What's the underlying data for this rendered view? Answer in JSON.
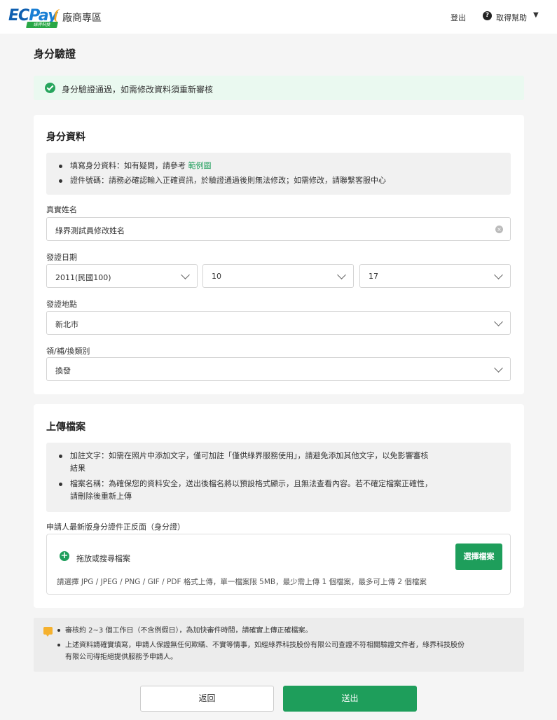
{
  "header": {
    "logo_text_ec": "EC",
    "logo_text_pay": "Pay",
    "logo_tagline": "綠界科技",
    "portal_title": "廠商專區",
    "logout_label": "登出",
    "help_label": "取得幫助"
  },
  "page": {
    "title": "身分驗證",
    "success_message": "身分驗證通過，如需修改資料須重新審核"
  },
  "identity_section": {
    "title": "身分資料",
    "notes": [
      {
        "text": "填寫身分資料：如有疑問，請參考 ",
        "link": "範例圖"
      },
      {
        "text": "證件號碼：請務必確認輸入正確資訊，於驗證通過後則無法修改；如需修改，請聯繫客服中心",
        "link": ""
      }
    ],
    "name_label": "真實姓名",
    "name_value": "綠界測試員修改姓名",
    "issue_date_label": "發證日期",
    "issue_year": "2011(民國100)",
    "issue_month": "10",
    "issue_day": "17",
    "issue_place_label": "發證地點",
    "issue_place": "新北市",
    "issue_type_label": "領/補/換類別",
    "issue_type": "換發"
  },
  "upload_section": {
    "title": "上傳檔案",
    "notes": [
      "加註文字：如需在照片中添加文字，僅可加註「僅供綠界服務使用」，請避免添加其他文字，以免影響審核",
      "結果",
      "檔案名稱：為確保您的資料安全，送出後檔名將以預設格式顯示，且無法查看內容。若不確定檔案正確性，",
      "請刪除後重新上傳"
    ],
    "file_label": "申請人最新版身分證件正反面（身分證）",
    "drop_label": "拖放或搜尋檔案",
    "choose_button": "選擇檔案",
    "hint": "請選擇 JPG / JPEG / PNG / GIF / PDF 格式上傳，單一檔案限 5MB，最少需上傳 1 個檔案，最多可上傳 2 個檔案"
  },
  "notice": {
    "lines": [
      "審核約 2~3 個工作日（不含例假日），為加快審件時間，請確實上傳正確檔案。",
      "上述資料請確實填寫，申請人保證無任何欺瞞、不實等情事，如經綠界科技股份有限公司查證不符相關驗證文件者，綠界科技股份",
      "有限公司得拒絕提供服務予申請人。"
    ]
  },
  "actions": {
    "back_label": "返回",
    "submit_label": "送出"
  },
  "colors": {
    "accent_green": "#1e9e5b",
    "success_bg": "#eaf9f0",
    "brand_blue": "#0f5fb0",
    "warning_yellow": "#f5b12e"
  }
}
